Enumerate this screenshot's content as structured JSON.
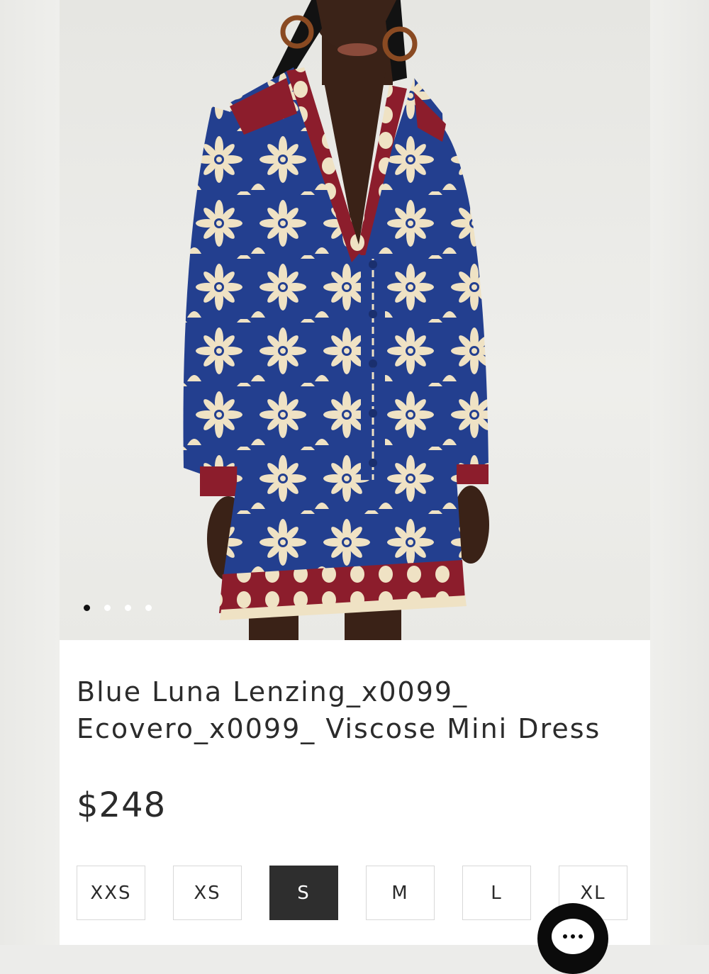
{
  "product": {
    "title_line1": "Blue Luna Lenzing_x0099_",
    "title_line2": "Ecovero_x0099_ Viscose Mini Dress",
    "price": "$248",
    "image_alt": "model-wearing-blue-floral-mini-dress",
    "gallery": {
      "total_images": 4,
      "active_index": 0
    },
    "sizes": [
      "XXS",
      "XS",
      "S",
      "M",
      "L",
      "XL"
    ],
    "selected_size": "S"
  },
  "colors": {
    "dress_blue": "#233f8f",
    "flower_cream": "#efe2c4",
    "trim_red": "#8c1d2c",
    "selected_bg": "#2e2e2e",
    "chat_bg": "#0b0b0b"
  },
  "chat": {
    "icon": "chat-bubble-icon"
  }
}
